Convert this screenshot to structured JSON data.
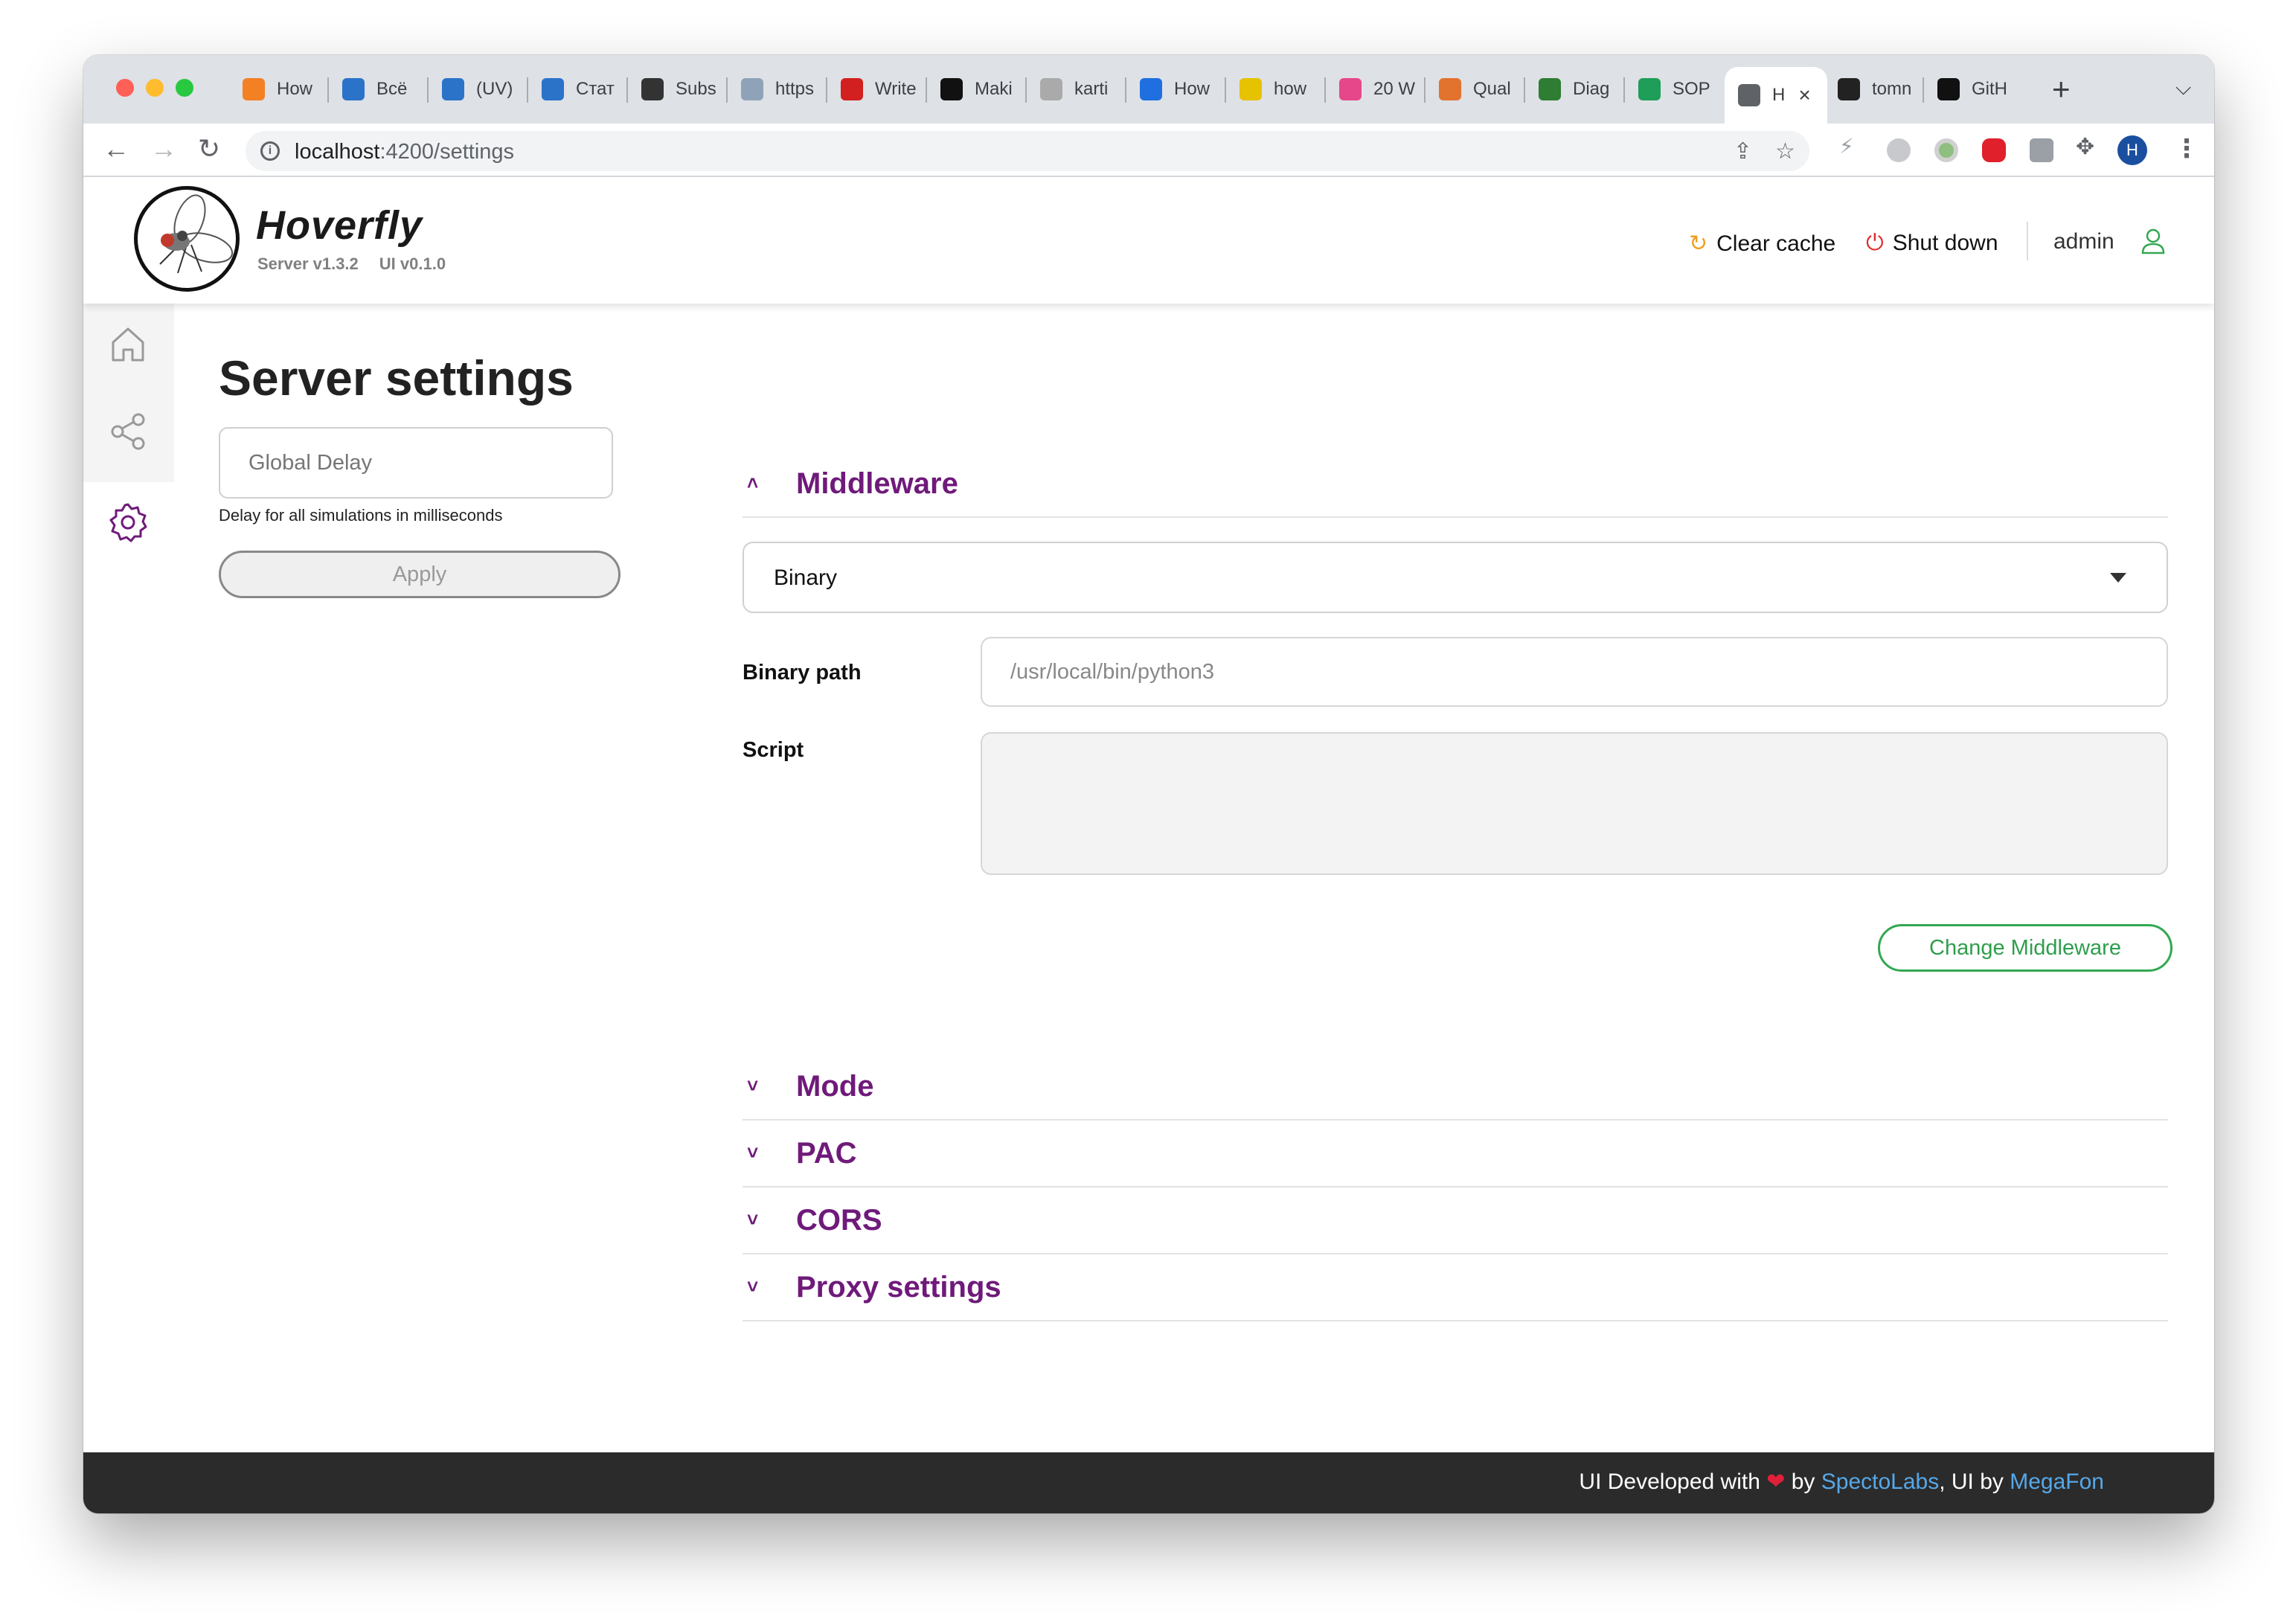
{
  "browser": {
    "tabs": [
      {
        "label": "How",
        "icon": "stackoverflow-icon",
        "color": "#f48024"
      },
      {
        "label": "Всё",
        "icon": "d-icon",
        "color": "#2a73c9"
      },
      {
        "label": "(UV)",
        "icon": "d-icon",
        "color": "#2a73c9"
      },
      {
        "label": "Стат",
        "icon": "d-icon",
        "color": "#2a73c9"
      },
      {
        "label": "Subs",
        "icon": "d-icon",
        "color": "#333333"
      },
      {
        "label": "https",
        "icon": "cloud-icon",
        "color": "#8fa3b8"
      },
      {
        "label": "Write",
        "icon": "lightning-icon",
        "color": "#d21f1f"
      },
      {
        "label": "Maki",
        "icon": "dot-icon",
        "color": "#111111"
      },
      {
        "label": "karti",
        "icon": "puzzle-icon",
        "color": "#aaaaaa"
      },
      {
        "label": "How",
        "icon": "confluence-icon",
        "color": "#1f6fe0"
      },
      {
        "label": "how",
        "icon": "ruler-icon",
        "color": "#e6c200"
      },
      {
        "label": "20 W",
        "icon": "f-icon",
        "color": "#e6478a"
      },
      {
        "label": "Qual",
        "icon": "gitlab-icon",
        "color": "#e2732e"
      },
      {
        "label": "Diag",
        "icon": "diag-icon",
        "color": "#2e7d32"
      },
      {
        "label": "SOP",
        "icon": "sheets-icon",
        "color": "#1e9e58"
      },
      {
        "label": "H",
        "icon": "globe-icon",
        "color": "#5f6368",
        "active": true
      },
      {
        "label": "tomn",
        "icon": "tomn-icon",
        "color": "#222222"
      },
      {
        "label": "GitH",
        "icon": "github-icon",
        "color": "#111111"
      }
    ],
    "url_host": "localhost",
    "url_path": ":4200/settings",
    "profile_initial": "H"
  },
  "header": {
    "brand": "Hoverfly",
    "server_version": "Server v1.3.2",
    "ui_version": "UI v0.1.0",
    "clear_cache": "Clear cache",
    "shut_down": "Shut down",
    "user": "admin"
  },
  "left": {
    "title": "Server settings",
    "delay_placeholder": "Global Delay",
    "delay_hint": "Delay for all simulations in milliseconds",
    "apply_label": "Apply"
  },
  "middleware": {
    "title": "Middleware",
    "selected": "Binary",
    "binary_path_label": "Binary path",
    "binary_path_value": "/usr/local/bin/python3",
    "script_label": "Script",
    "script_value": "",
    "change_label": "Change Middleware"
  },
  "sections": {
    "mode": "Mode",
    "pac": "PAC",
    "cors": "CORS",
    "proxy": "Proxy settings"
  },
  "footer": {
    "prefix": "UI Developed with",
    "heart": "❤",
    "by1": "by",
    "link1": "SpectoLabs",
    "by2": ", UI by",
    "link2": "MegaFon"
  },
  "colors": {
    "accent_purple": "#6f1a7a",
    "accent_green": "#33a852",
    "link_blue": "#56a8e8"
  }
}
